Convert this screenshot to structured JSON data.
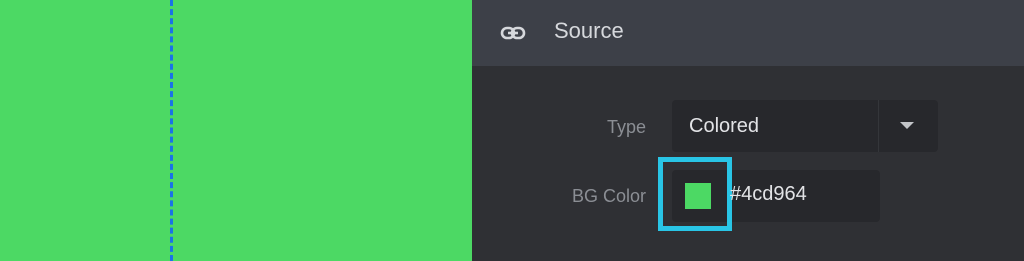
{
  "canvas": {
    "bg_color": "#4cd964"
  },
  "colors": {
    "guide_line": "#1a73e8",
    "highlight_border": "#29c5e6",
    "panel_bg": "#2f3034",
    "header_bg": "#3d4048"
  },
  "panel": {
    "header": {
      "icon": "link-icon",
      "title": "Source"
    },
    "type_field": {
      "label": "Type",
      "value": "Colored",
      "icon": "chevron-down-icon"
    },
    "bg_color_field": {
      "label": "BG Color",
      "value": "#4cd964",
      "swatch_color": "#4cd964"
    }
  }
}
